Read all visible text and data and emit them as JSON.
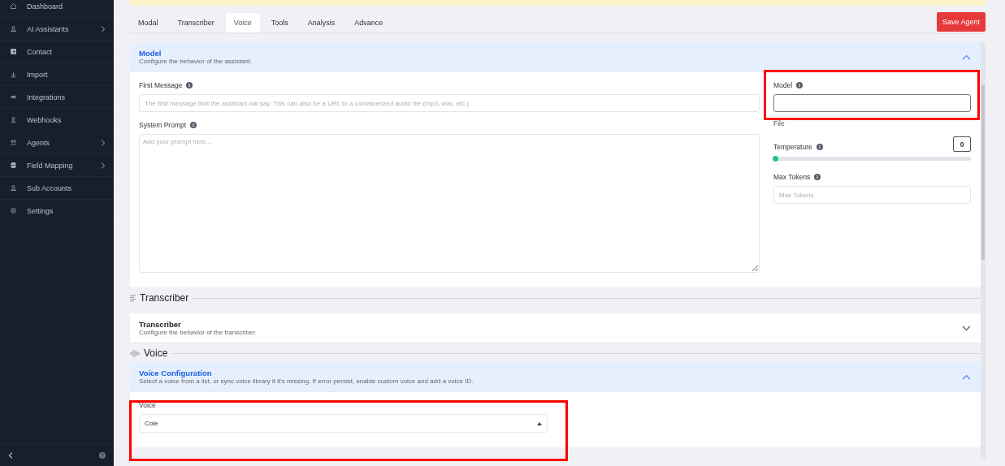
{
  "sidebar": {
    "items": [
      {
        "label": "Dashboard",
        "has_submenu": false
      },
      {
        "label": "AI Assistants",
        "has_submenu": true
      },
      {
        "label": "Contact",
        "has_submenu": false
      },
      {
        "label": "Import",
        "has_submenu": false
      },
      {
        "label": "Integrations",
        "has_submenu": false
      },
      {
        "label": "Webhooks",
        "has_submenu": false
      },
      {
        "label": "Agents",
        "has_submenu": true
      },
      {
        "label": "Field Mapping",
        "has_submenu": true
      },
      {
        "label": "Sub Accounts",
        "has_submenu": false
      },
      {
        "label": "Settings",
        "has_submenu": false
      }
    ]
  },
  "tabs": [
    {
      "label": "Modal",
      "selected": false
    },
    {
      "label": "Transcriber",
      "selected": false
    },
    {
      "label": "Voice",
      "selected": true
    },
    {
      "label": "Tools",
      "selected": false
    },
    {
      "label": "Analysis",
      "selected": false
    },
    {
      "label": "Advance",
      "selected": false
    }
  ],
  "save_button": "Save Agent",
  "model_card": {
    "title": "Model",
    "description": "Configure the behavior of the assistant.",
    "expanded": true,
    "first_message": {
      "label": "First Message",
      "placeholder": "The first message that the assistant will say. This can also be a URL to a containerized audio file (mp3, wav, etc.)."
    },
    "system_prompt": {
      "label": "System Prompt",
      "placeholder": "Add your prompt here..."
    },
    "model": {
      "label": "Model"
    },
    "file_label": "File",
    "temperature": {
      "label": "Temperature",
      "reading": "0",
      "level": 0
    },
    "max_tokens": {
      "label": "Max Tokens",
      "placeholder": "Max Tokens"
    }
  },
  "transcriber_heading": "Transcriber",
  "transcriber_card": {
    "title": "Transcriber",
    "description": "Configure the behavior of the transcriber.",
    "expanded": false
  },
  "voice_heading": "Voice",
  "voice_card": {
    "title": "Voice Configuration",
    "description": "Select a voice from a list, or sync voice library it it's missing. If error persist, enable custom voice and add a voice ID.",
    "expanded": true,
    "voice": {
      "label": "Voice",
      "value": "Cole"
    }
  }
}
